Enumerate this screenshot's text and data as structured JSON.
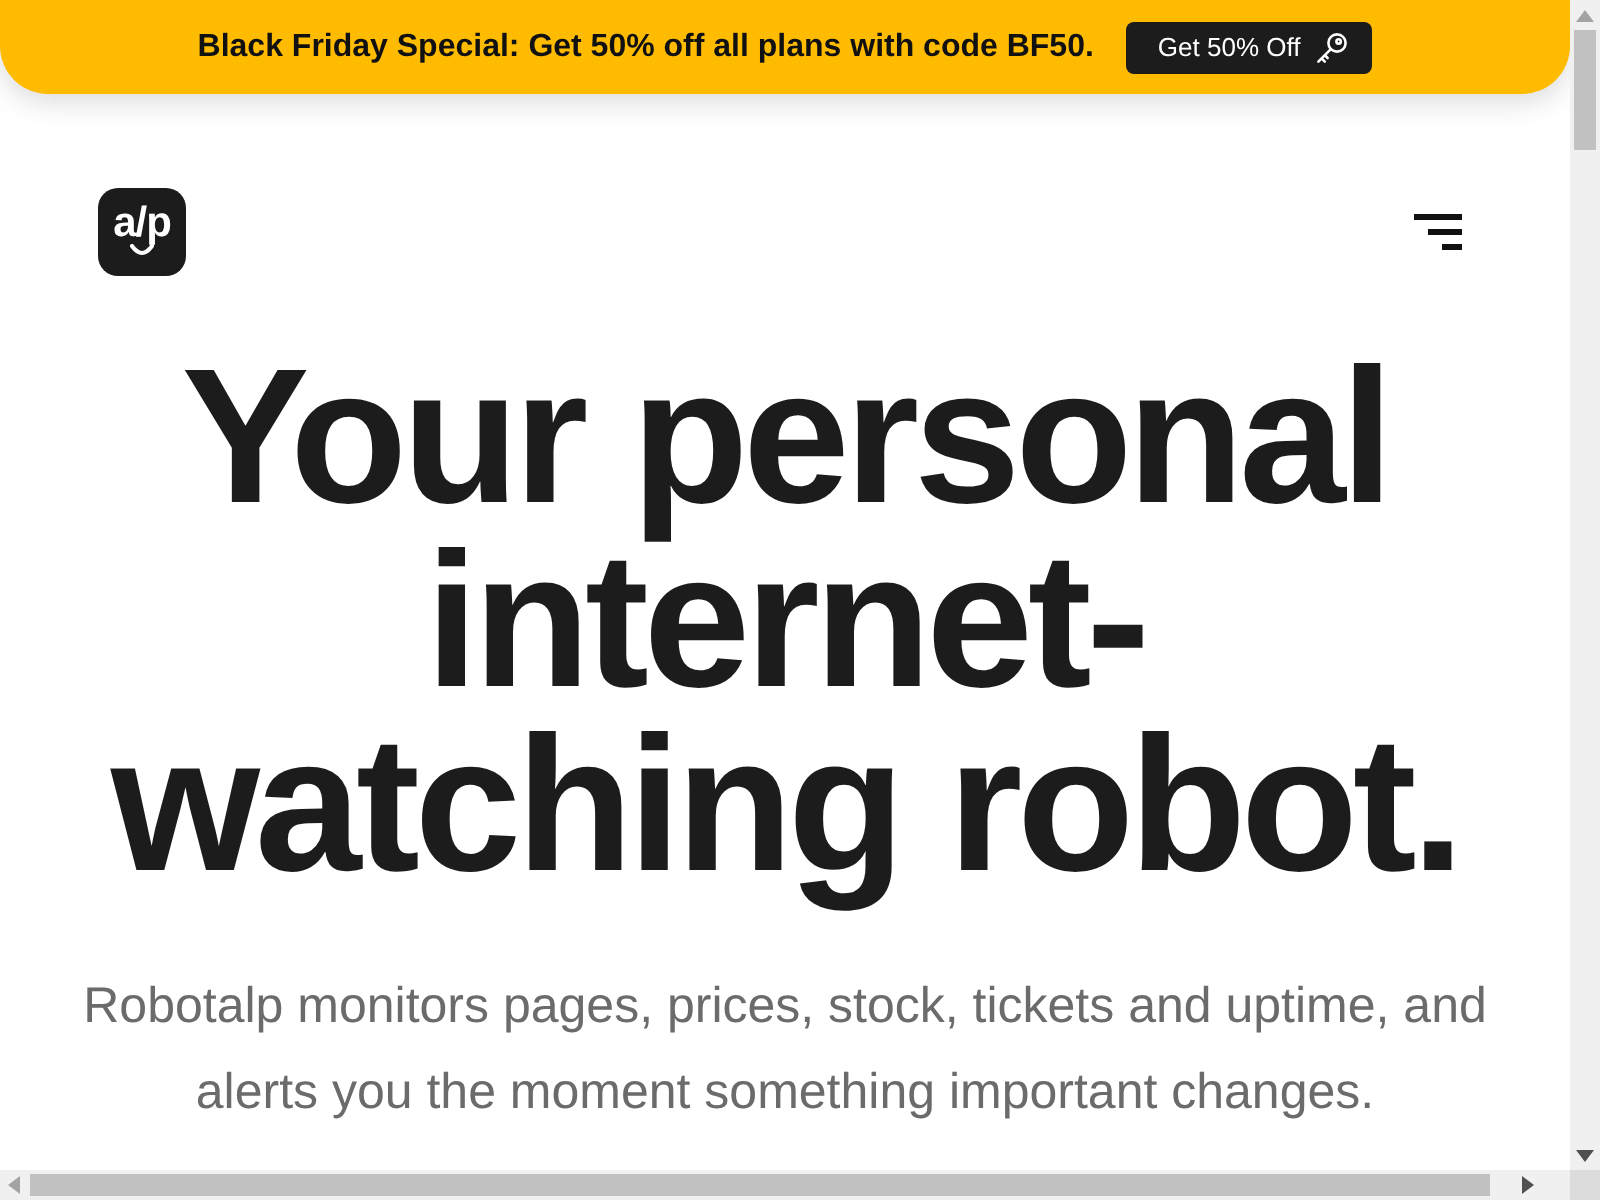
{
  "promo_banner": {
    "text": "Black Friday Special: Get 50% off all plans with code BF50.",
    "button": "Get 50% Off"
  },
  "header": {
    "logo_text": "a/p"
  },
  "hero": {
    "heading": "Your personal internet-watching robot.",
    "subheading": "Robotalp monitors pages, prices, stock, tickets and uptime, and alerts you the moment something important changes."
  }
}
